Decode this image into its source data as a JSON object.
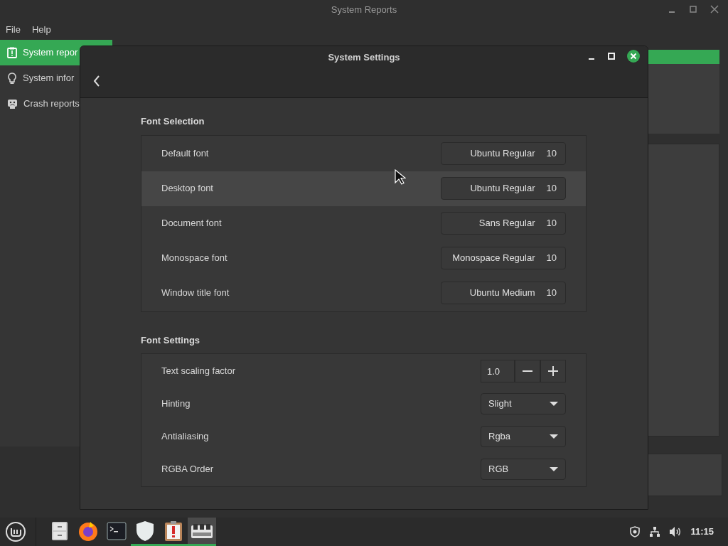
{
  "background_window": {
    "title": "System Reports",
    "menu": [
      "File",
      "Help"
    ],
    "sidebar": {
      "items": [
        {
          "label": "System repor",
          "selected": true
        },
        {
          "label": "System infor",
          "selected": false
        },
        {
          "label": "Crash reports",
          "selected": false
        }
      ]
    }
  },
  "dialog": {
    "title": "System Settings",
    "sections": [
      {
        "title": "Font Selection",
        "rows": [
          {
            "kind": "font",
            "label": "Default font",
            "font": "Ubuntu Regular",
            "size": "10",
            "hovered": false
          },
          {
            "kind": "font",
            "label": "Desktop font",
            "font": "Ubuntu Regular",
            "size": "10",
            "hovered": true
          },
          {
            "kind": "font",
            "label": "Document font",
            "font": "Sans Regular",
            "size": "10",
            "hovered": false
          },
          {
            "kind": "font",
            "label": "Monospace font",
            "font": "Monospace Regular",
            "size": "10",
            "hovered": false
          },
          {
            "kind": "font",
            "label": "Window title font",
            "font": "Ubuntu Medium",
            "size": "10",
            "hovered": false
          }
        ]
      },
      {
        "title": "Font Settings",
        "rows": [
          {
            "kind": "spin",
            "label": "Text scaling factor",
            "value": "1.0",
            "hovered": false
          },
          {
            "kind": "dropdown",
            "label": "Hinting",
            "value": "Slight",
            "hovered": false
          },
          {
            "kind": "dropdown",
            "label": "Antialiasing",
            "value": "Rgba",
            "hovered": false
          },
          {
            "kind": "dropdown",
            "label": "RGBA Order",
            "value": "RGB",
            "hovered": false
          }
        ]
      }
    ]
  },
  "taskbar": {
    "items": [
      {
        "running": false,
        "selected": false
      },
      {
        "running": false,
        "selected": false
      },
      {
        "running": false,
        "selected": false
      },
      {
        "running": true,
        "selected": false
      },
      {
        "running": true,
        "selected": false
      },
      {
        "running": true,
        "selected": true
      }
    ],
    "clock": "11:15"
  }
}
